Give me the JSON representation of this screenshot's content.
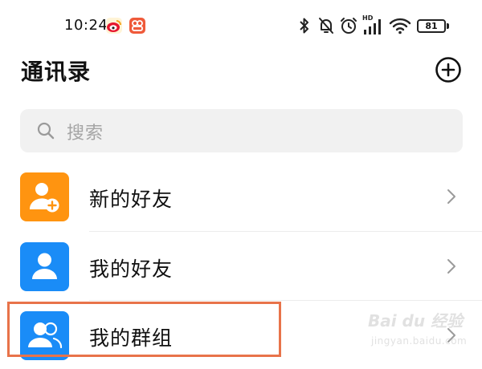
{
  "status_bar": {
    "time": "10:24",
    "battery_level": "81",
    "hd_label": "HD",
    "icons": [
      "weibo-icon",
      "app-icon",
      "bluetooth-icon",
      "mute-bell-icon",
      "alarm-icon",
      "signal-icon",
      "wifi-icon",
      "battery-icon"
    ]
  },
  "header": {
    "title": "通讯录",
    "add_icon": "plus-circle-icon"
  },
  "search": {
    "placeholder": "搜索",
    "icon": "search-icon"
  },
  "list": {
    "items": [
      {
        "label": "新的好友",
        "icon": "add-friend-icon",
        "icon_color": "#ff9410"
      },
      {
        "label": "我的好友",
        "icon": "friend-icon",
        "icon_color": "#1a8cf7"
      },
      {
        "label": "我的群组",
        "icon": "group-icon",
        "icon_color": "#1a8cf7"
      }
    ]
  },
  "highlight": {
    "color": "#e8734a",
    "target": "我的群组"
  },
  "watermark": {
    "logo": "Bai du 经验",
    "sub": "jingyan.baidu.com"
  },
  "colors": {
    "accent_orange": "#ff9410",
    "accent_blue": "#1a8cf7",
    "search_bg": "#f1f1f1",
    "placeholder": "#a5a5a5"
  }
}
